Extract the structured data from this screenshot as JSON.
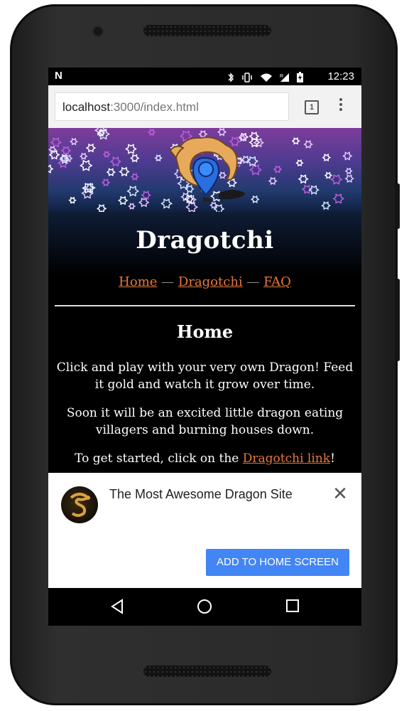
{
  "status_bar": {
    "left_icon": "N",
    "time": "12:23",
    "icons": [
      "bluetooth-icon",
      "vibrate-icon",
      "wifi-icon",
      "signal-icon",
      "battery-icon"
    ]
  },
  "browser": {
    "url_host": "localhost",
    "url_rest": ":3000/index.html",
    "tab_count": "1"
  },
  "site": {
    "title": "Dragotchi",
    "nav": {
      "home": "Home",
      "sep": "—",
      "dragotchi": "Dragotchi",
      "faq": "FAQ"
    },
    "heading": "Home",
    "para1": "Click and play with your very own Dragon! Feed it gold and watch it grow over time.",
    "para2": "Soon it will be an excited little dragon eating villagers and burning houses down.",
    "para3_pre": "To get started, click on the ",
    "para3_link": "Dragotchi link",
    "para3_post": "!"
  },
  "add_to_home": {
    "site_name": "The Most Awesome Dragon Site",
    "button_label": "ADD TO HOME SCREEN",
    "close_label": "✕"
  },
  "colors": {
    "link": "#e8763a",
    "button": "#4285f4"
  }
}
